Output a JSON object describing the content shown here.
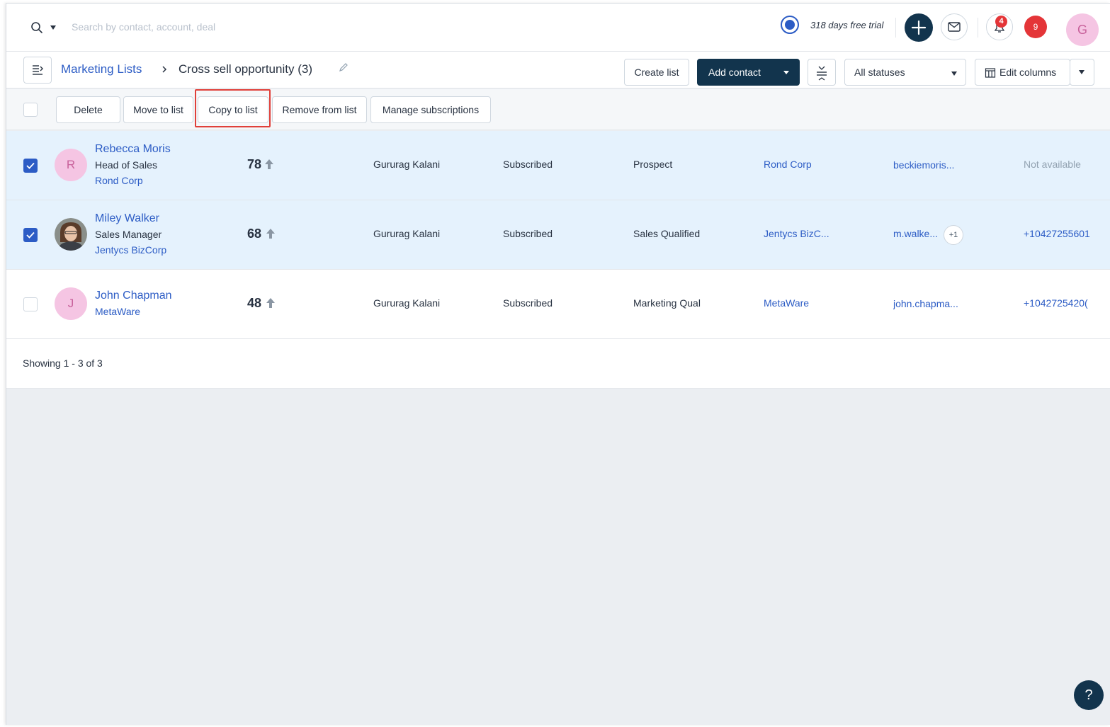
{
  "topbar": {
    "search_placeholder": "Search by contact, account, deal",
    "trial_text": "318 days free trial",
    "notification_count": "4",
    "alerts_count": "9",
    "user_initial": "G"
  },
  "breadcrumb": {
    "parent": "Marketing Lists",
    "current": "Cross sell opportunity",
    "count": "(3)"
  },
  "header_actions": {
    "create_list": "Create list",
    "add_contact": "Add contact",
    "status_filter": "All statuses",
    "edit_columns": "Edit columns"
  },
  "bulk_actions": {
    "delete": "Delete",
    "move_to_list": "Move to list",
    "copy_to_list": "Copy to list",
    "remove_from_list": "Remove from list",
    "manage_subscriptions": "Manage subscriptions"
  },
  "rows": [
    {
      "selected": true,
      "initial": "R",
      "name": "Rebecca Moris",
      "title": "Head of Sales",
      "company": "Rond Corp",
      "score": "78",
      "owner": "Gururag Kalani",
      "subscription": "Subscribed",
      "stage": "Prospect",
      "account": "Rond Corp",
      "email": "beckiemoris...",
      "extra_emails": "",
      "phone": "Not available"
    },
    {
      "selected": true,
      "initial": "",
      "name": "Miley Walker",
      "title": "Sales Manager",
      "company": "Jentycs BizCorp",
      "score": "68",
      "owner": "Gururag Kalani",
      "subscription": "Subscribed",
      "stage": "Sales Qualified",
      "account": "Jentycs BizC...",
      "email": "m.walke...",
      "extra_emails": "+1",
      "phone": "+10427255601"
    },
    {
      "selected": false,
      "initial": "J",
      "name": "John Chapman",
      "title": "",
      "company": "MetaWare",
      "score": "48",
      "owner": "Gururag Kalani",
      "subscription": "Subscribed",
      "stage": "Marketing Qual",
      "account": "MetaWare",
      "email": "john.chapma...",
      "extra_emails": "",
      "phone": "+1042725420("
    }
  ],
  "footer": {
    "showing": "Showing 1 - 3 of 3"
  },
  "help": {
    "label": "?"
  },
  "colors": {
    "primary": "#12344d",
    "link": "#2c5cc5",
    "selected_row": "#e5f2fd",
    "badge": "#e43538",
    "highlight": "#e0403a"
  }
}
